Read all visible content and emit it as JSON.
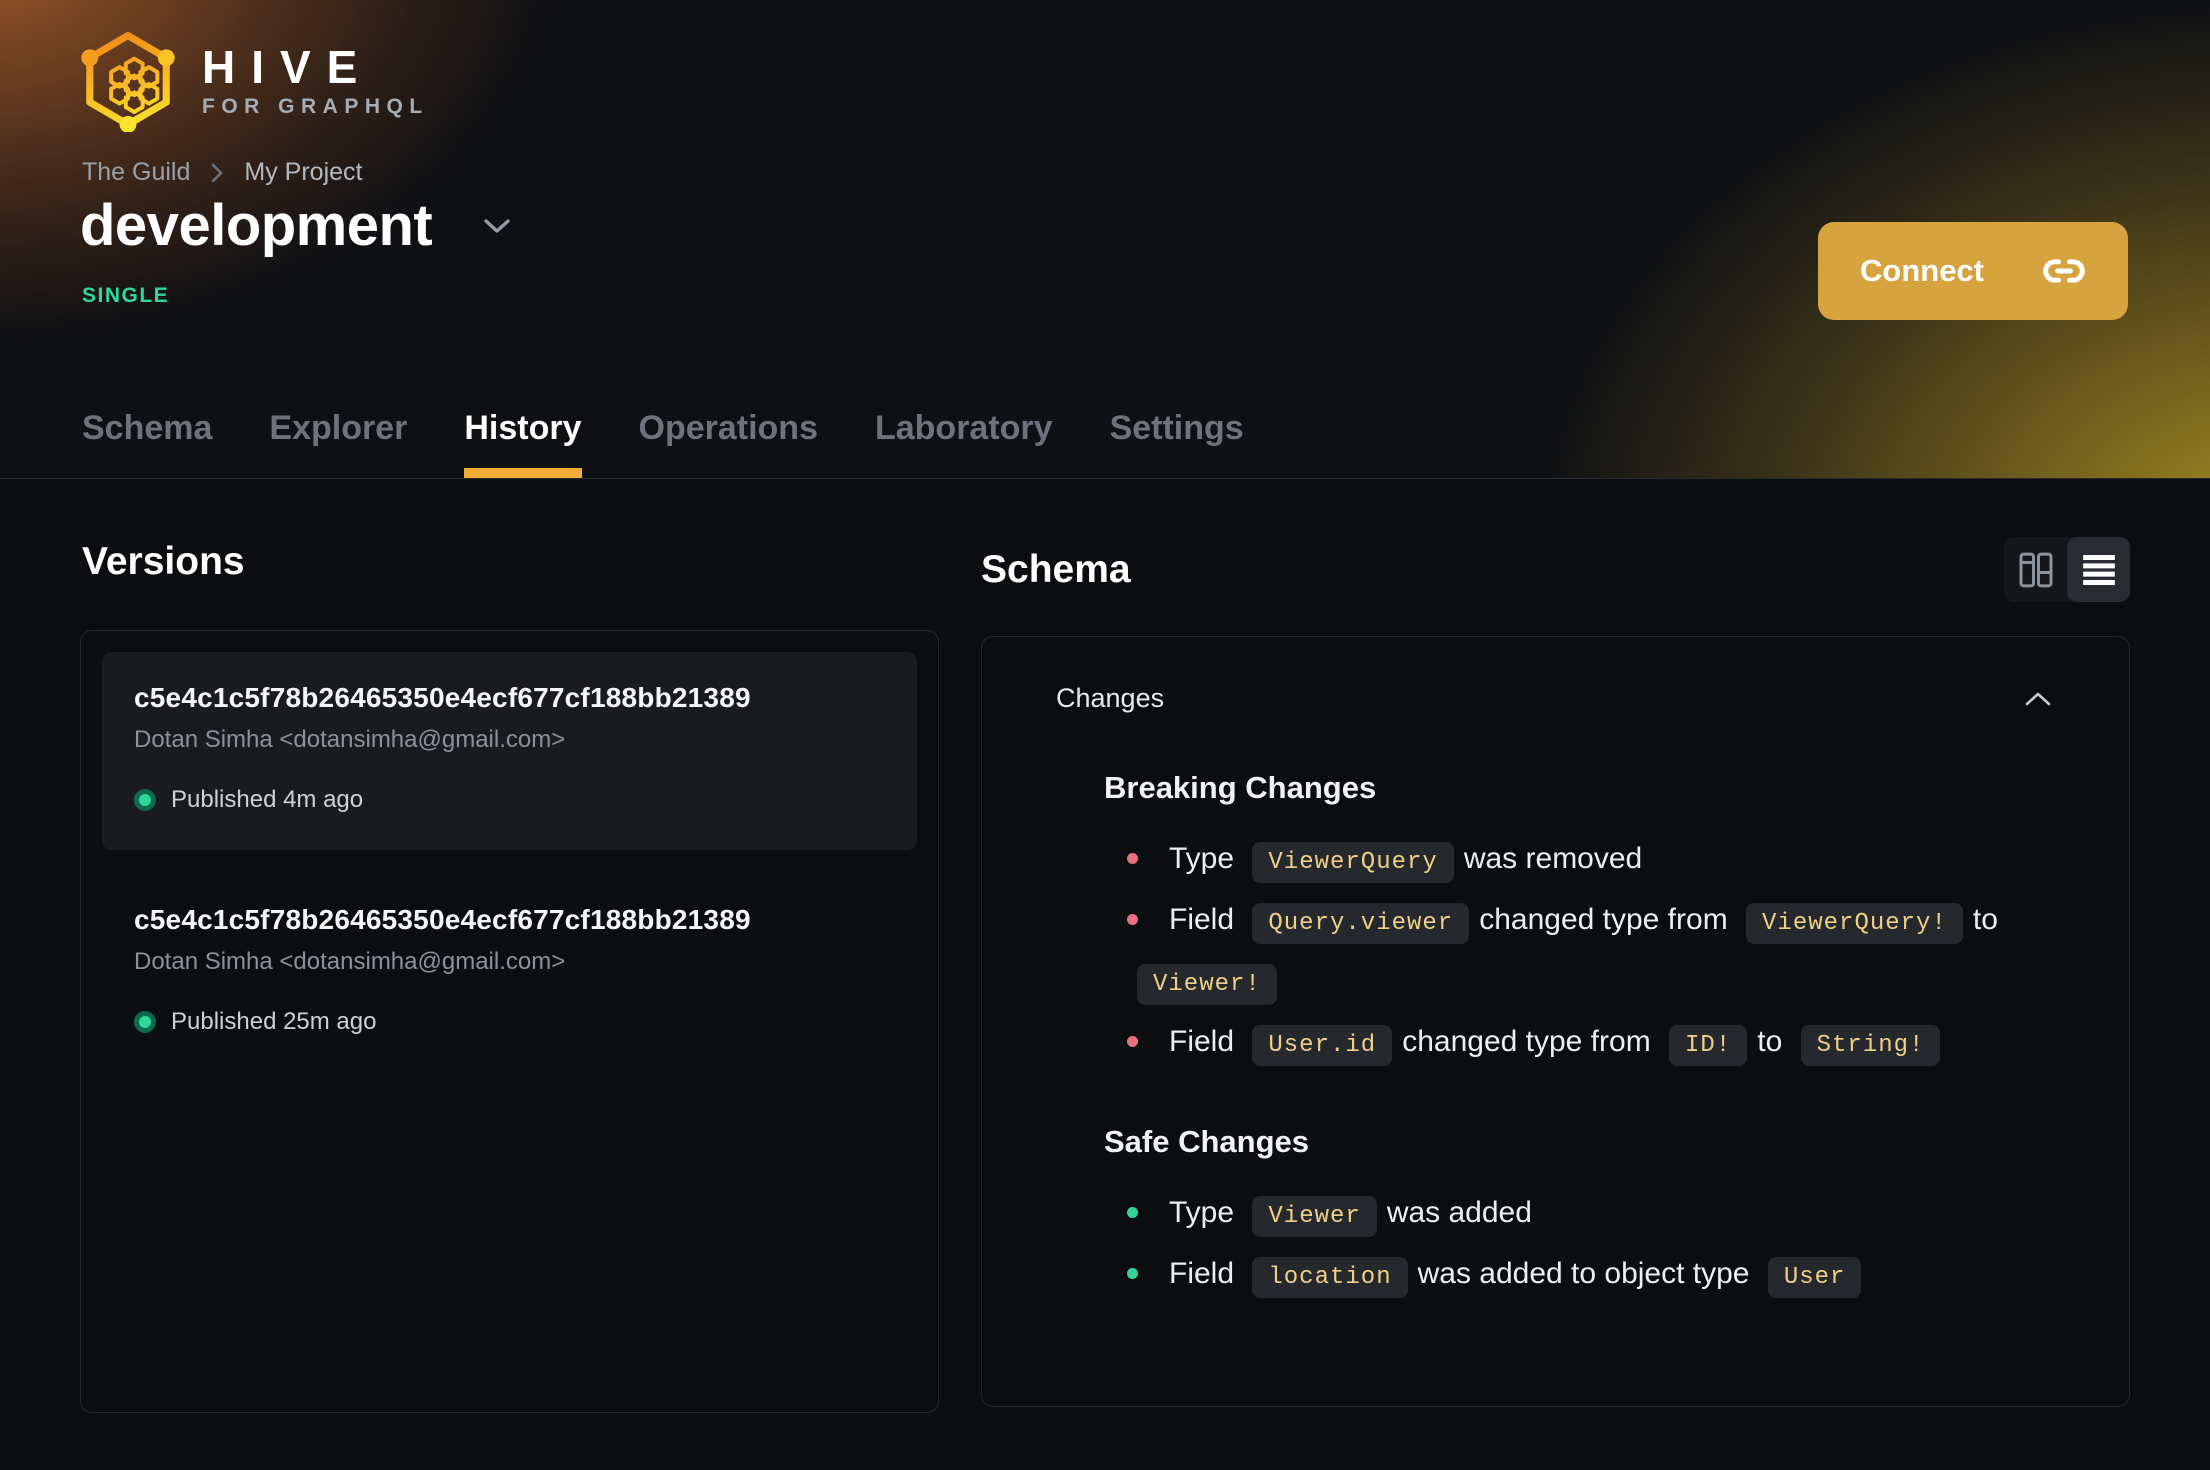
{
  "brand": {
    "name": "HIVE",
    "tagline": "FOR GRAPHQL"
  },
  "breadcrumb": {
    "org": "The Guild",
    "project": "My Project"
  },
  "target": {
    "name": "development",
    "badge": "SINGLE"
  },
  "connect": {
    "label": "Connect"
  },
  "tabs": [
    {
      "label": "Schema",
      "active": false
    },
    {
      "label": "Explorer",
      "active": false
    },
    {
      "label": "History",
      "active": true
    },
    {
      "label": "Operations",
      "active": false
    },
    {
      "label": "Laboratory",
      "active": false
    },
    {
      "label": "Settings",
      "active": false
    }
  ],
  "versions": {
    "title": "Versions",
    "items": [
      {
        "hash": "c5e4c1c5f78b26465350e4ecf677cf188bb21389",
        "author": "Dotan Simha <dotansimha@gmail.com>",
        "status": "Published 4m ago",
        "selected": true
      },
      {
        "hash": "c5e4c1c5f78b26465350e4ecf677cf188bb21389",
        "author": "Dotan Simha <dotansimha@gmail.com>",
        "status": "Published 25m ago",
        "selected": false
      }
    ]
  },
  "schema_panel": {
    "title": "Schema",
    "view_modes": [
      {
        "icon": "columns-view-icon",
        "active": false
      },
      {
        "icon": "list-view-icon",
        "active": true
      }
    ]
  },
  "changes": {
    "title": "Changes",
    "sections": [
      {
        "id": "breaking",
        "title": "Breaking Changes",
        "items": [
          [
            {
              "t": "text",
              "v": "Type"
            },
            {
              "t": "code",
              "v": "ViewerQuery"
            },
            {
              "t": "text",
              "v": "was removed"
            }
          ],
          [
            {
              "t": "text",
              "v": "Field"
            },
            {
              "t": "code",
              "v": "Query.viewer"
            },
            {
              "t": "text",
              "v": "changed type from"
            },
            {
              "t": "code",
              "v": "ViewerQuery!"
            },
            {
              "t": "text",
              "v": "to"
            },
            {
              "t": "code",
              "v": "Viewer!"
            }
          ],
          [
            {
              "t": "text",
              "v": "Field"
            },
            {
              "t": "code",
              "v": "User.id"
            },
            {
              "t": "text",
              "v": "changed type from"
            },
            {
              "t": "code",
              "v": "ID!"
            },
            {
              "t": "text",
              "v": "to"
            },
            {
              "t": "code",
              "v": "String!"
            }
          ]
        ]
      },
      {
        "id": "safe",
        "title": "Safe Changes",
        "items": [
          [
            {
              "t": "text",
              "v": "Type"
            },
            {
              "t": "code",
              "v": "Viewer"
            },
            {
              "t": "text",
              "v": "was added"
            }
          ],
          [
            {
              "t": "text",
              "v": "Field"
            },
            {
              "t": "code",
              "v": "location"
            },
            {
              "t": "text",
              "v": "was added to object type"
            },
            {
              "t": "code",
              "v": "User"
            }
          ]
        ]
      }
    ]
  },
  "colors": {
    "accent_amber": "#f2ad3a",
    "button_amber": "#d7a33e",
    "badge_green": "#30d79a",
    "published_dot": "#2fd79b",
    "breaking_bullet": "#e9717d",
    "safe_bullet": "#33d39a",
    "chip_text": "#f1d086",
    "chip_bg": "#25282c",
    "page_bg": "#0b0d10"
  },
  "icons": {
    "logo": "hive-logo-icon",
    "breadcrumb_separator": "chevron-right-icon",
    "title_caret": "chevron-down-icon",
    "connect": "link-icon",
    "view_left": "columns-view-icon",
    "view_right": "list-view-icon",
    "collapse": "chevron-up-icon",
    "status": "published-dot-icon"
  }
}
